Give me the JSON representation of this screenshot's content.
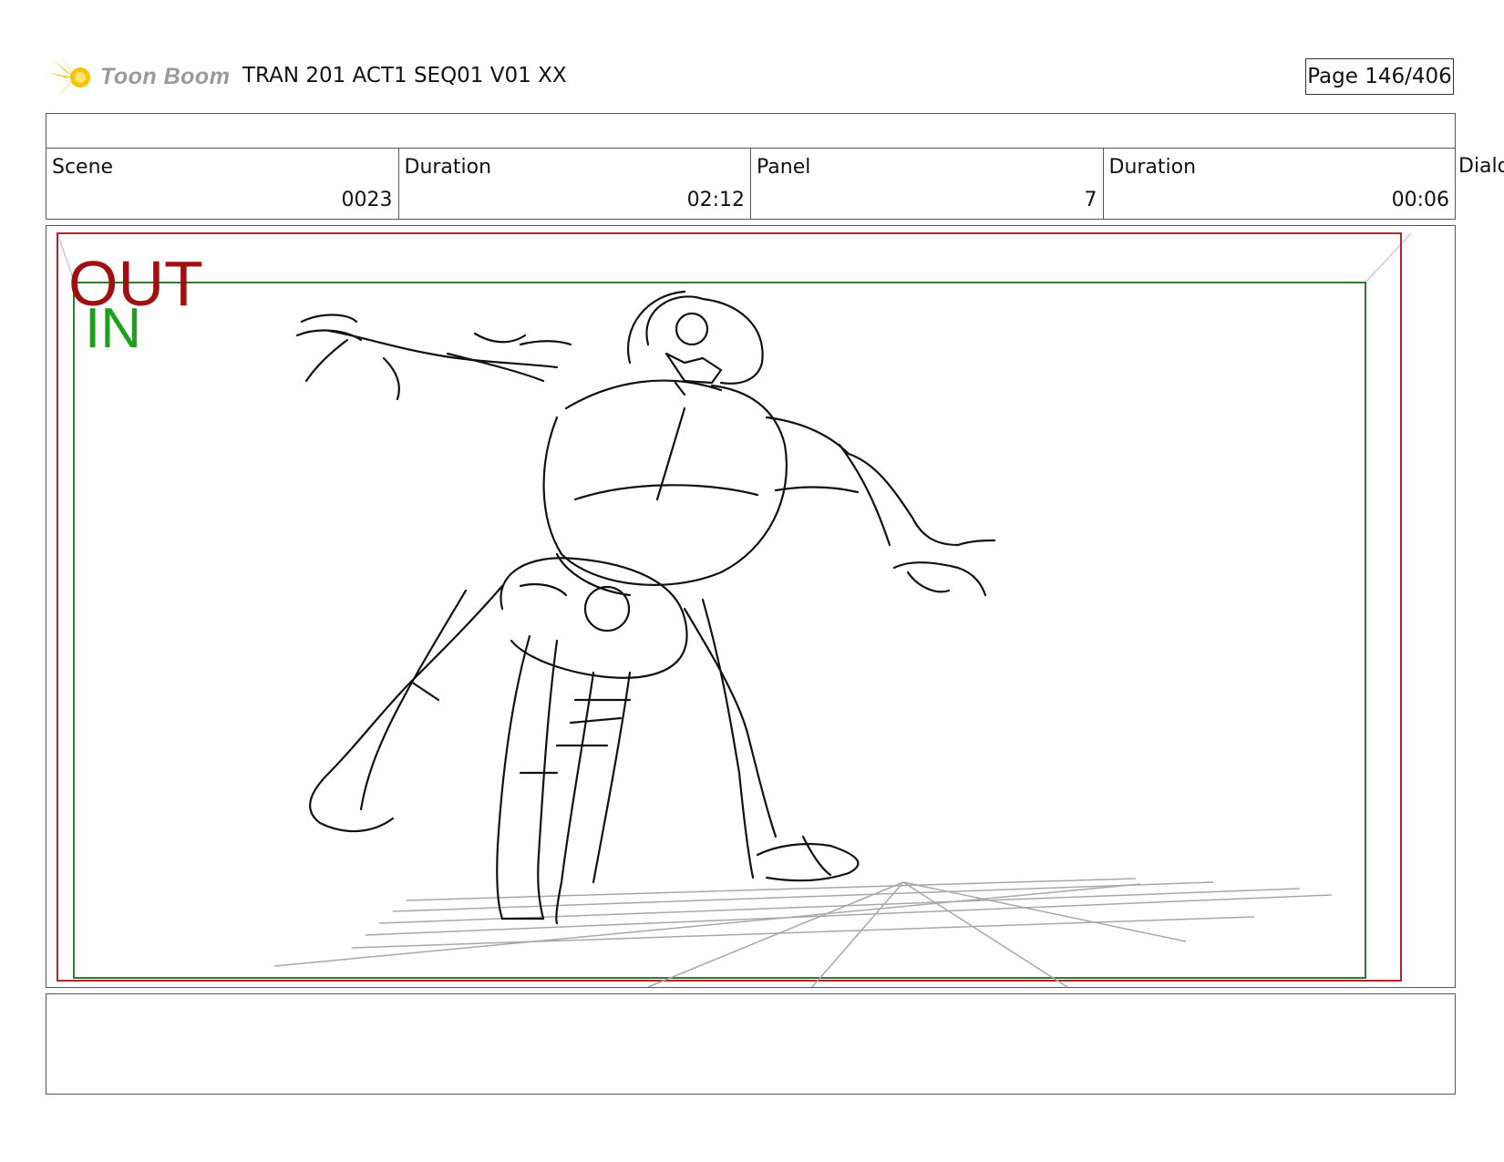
{
  "header": {
    "logo_text": "Toon Boom",
    "title": "TRAN 201 ACT1 SEQ01 V01 XX",
    "page": "Page 146/406"
  },
  "info": {
    "scene_label": "Scene",
    "scene_value": "0023",
    "scene_duration_label": "Duration",
    "scene_duration_value": "02:12",
    "panel_label": "Panel",
    "panel_value": "7",
    "panel_duration_label": "Duration",
    "panel_duration_value": "00:06",
    "dialog_label": "Dialog"
  },
  "panel": {
    "out_label": "OUT",
    "in_label": "IN",
    "colors": {
      "out_frame": "#b0262e",
      "in_frame": "#2e7d32",
      "out_text": "#a01010",
      "in_text": "#1aa31a",
      "sketch": "#111111",
      "guides": "#a8a8a8"
    }
  },
  "notes": {
    "text": ""
  }
}
